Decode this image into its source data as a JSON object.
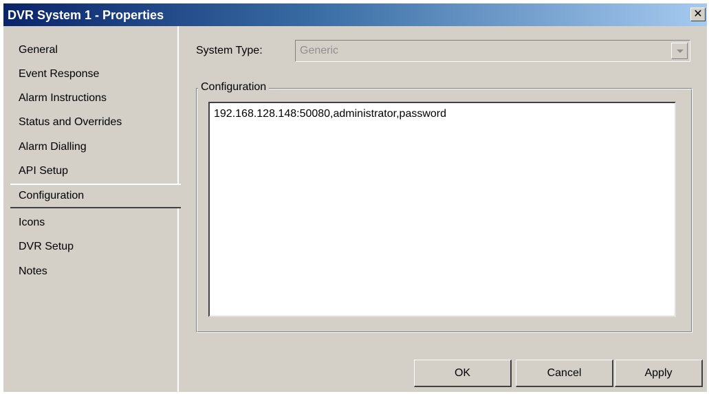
{
  "window": {
    "title": "DVR System 1 - Properties",
    "close_glyph": "✕"
  },
  "nav": {
    "items": [
      {
        "label": "General"
      },
      {
        "label": "Event Response"
      },
      {
        "label": "Alarm Instructions"
      },
      {
        "label": "Status and Overrides"
      },
      {
        "label": "Alarm Dialling"
      },
      {
        "label": "API Setup"
      },
      {
        "label": "Configuration",
        "selected": true
      },
      {
        "label": "Icons"
      },
      {
        "label": "DVR Setup"
      },
      {
        "label": "Notes"
      }
    ]
  },
  "form": {
    "system_type_label": "System Type:",
    "system_type_value": "Generic",
    "configuration_group_label": "Configuration",
    "configuration_value": "192.168.128.148:50080,administrator,password"
  },
  "buttons": {
    "ok": "OK",
    "cancel": "Cancel",
    "apply": "Apply"
  },
  "colors": {
    "dialog_bg": "#d4d0c8",
    "titlebar_start": "#0a246a",
    "titlebar_end": "#a6caf0",
    "disabled_text": "#8f8f8f"
  }
}
